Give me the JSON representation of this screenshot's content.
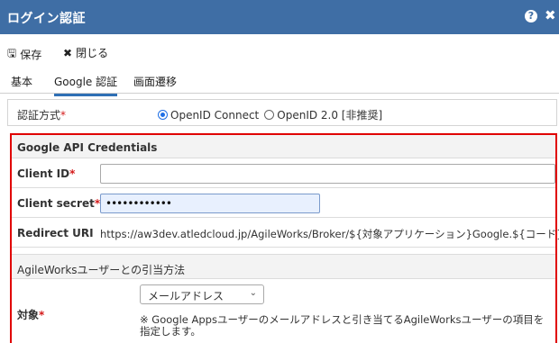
{
  "window": {
    "title": "ログイン認証",
    "help_icon": "?",
    "close_icon": "✖"
  },
  "toolbar": {
    "save_label": "保存",
    "close_label": "閉じる"
  },
  "tabs": [
    {
      "label": "基本"
    },
    {
      "label": "Google 認証",
      "active": true
    },
    {
      "label": "画面遷移"
    }
  ],
  "auth_method": {
    "label": "認証方式",
    "options": [
      {
        "label": "OpenID Connect",
        "selected": true
      },
      {
        "label": "OpenID 2.0 [非推奨]",
        "selected": false
      }
    ]
  },
  "credentials": {
    "heading": "Google API Credentials",
    "client_id": {
      "label": "Client ID",
      "value": ""
    },
    "client_secret": {
      "label": "Client secret",
      "value": "••••••••••••"
    },
    "redirect_uri": {
      "label": "Redirect URI",
      "value": "https://aw3dev.atledcloud.jp/AgileWorks/Broker/${対象アプリケーション}Google.${コード}"
    }
  },
  "mapping": {
    "heading": "AgileWorksユーザーとの引当方法",
    "target": {
      "label": "対象",
      "selected": "メールアドレス",
      "note": "※ Google Appsユーザーのメールアドレスと引き当てるAgileWorksユーザーの項目を指定します。"
    }
  },
  "colors": {
    "header": "#3f6ea5",
    "highlight": "#e00000",
    "required": "#d41a1a",
    "active_tab": "#2f6fb5"
  }
}
